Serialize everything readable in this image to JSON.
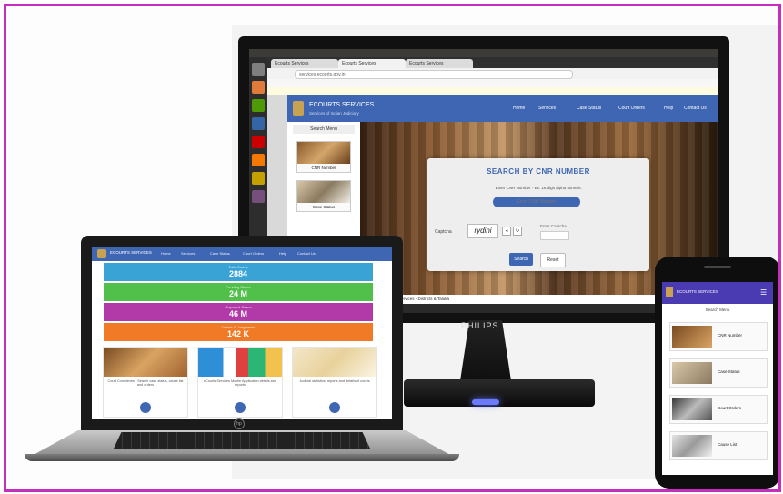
{
  "monitor": {
    "brand": "PHILIPS",
    "tabs": [
      "Ecourts Services",
      "Ecourts Services",
      "Ecourts Services"
    ],
    "url": "services.ecourts.gov.in",
    "site": {
      "title": "ECOURTS SERVICES",
      "subtitle": "Services of Indian Judiciary",
      "nav": [
        "Home",
        "Services",
        "Case Status",
        "Court Orders",
        "Help",
        "Contact Us"
      ]
    },
    "sidebar": {
      "heading": "Search Menu",
      "cards": [
        "CNR Number",
        "Case Status"
      ]
    },
    "modal": {
      "title": "SEARCH BY CNR NUMBER",
      "hint": "Enter CNR Number - Ex. 16 digit alpha numeric",
      "cnr_placeholder": "Enter CNR Number",
      "captcha_label": "Captcha",
      "captcha_text": "rydini",
      "captcha_input_label": "Enter Captcha",
      "search_label": "Search",
      "reset_label": "Reset"
    },
    "ticker": "Number of the cases from the all registered CNR Number  eServices - Districts & Taluka"
  },
  "laptop": {
    "nav_title": "ECOURTS SERVICES",
    "nav": [
      "Home",
      "Services",
      "Case Status",
      "Court Orders",
      "Help",
      "Contact Us"
    ],
    "stats": [
      {
        "caption": "Total Courts",
        "value": "2884"
      },
      {
        "caption": "Pending Cases",
        "value": "24 M"
      },
      {
        "caption": "Disposed Cases",
        "value": "46 M"
      },
      {
        "caption": "Orders & Judgments",
        "value": "142 K"
      }
    ],
    "cards": [
      "Court Complexes - Search case status, cause list and orders",
      "eCourts Services Mobile Application details and reports",
      "Judicial statistics, reports and details of courts"
    ]
  },
  "phone": {
    "title": "ECOURTS SERVICES",
    "menu_icon": "☰",
    "subtitle": "Search Menu",
    "cards": [
      "CNR Number",
      "Case Status",
      "Court Orders",
      "Cause List"
    ]
  },
  "colors": {
    "frame": "#c42fbf",
    "primary_blue": "#3f66b3",
    "stat_blue": "#3aa3d6",
    "stat_green": "#50c04a",
    "stat_purple": "#b23aa8",
    "stat_orange": "#f07a26",
    "phone_nav": "#4a3bb3"
  }
}
